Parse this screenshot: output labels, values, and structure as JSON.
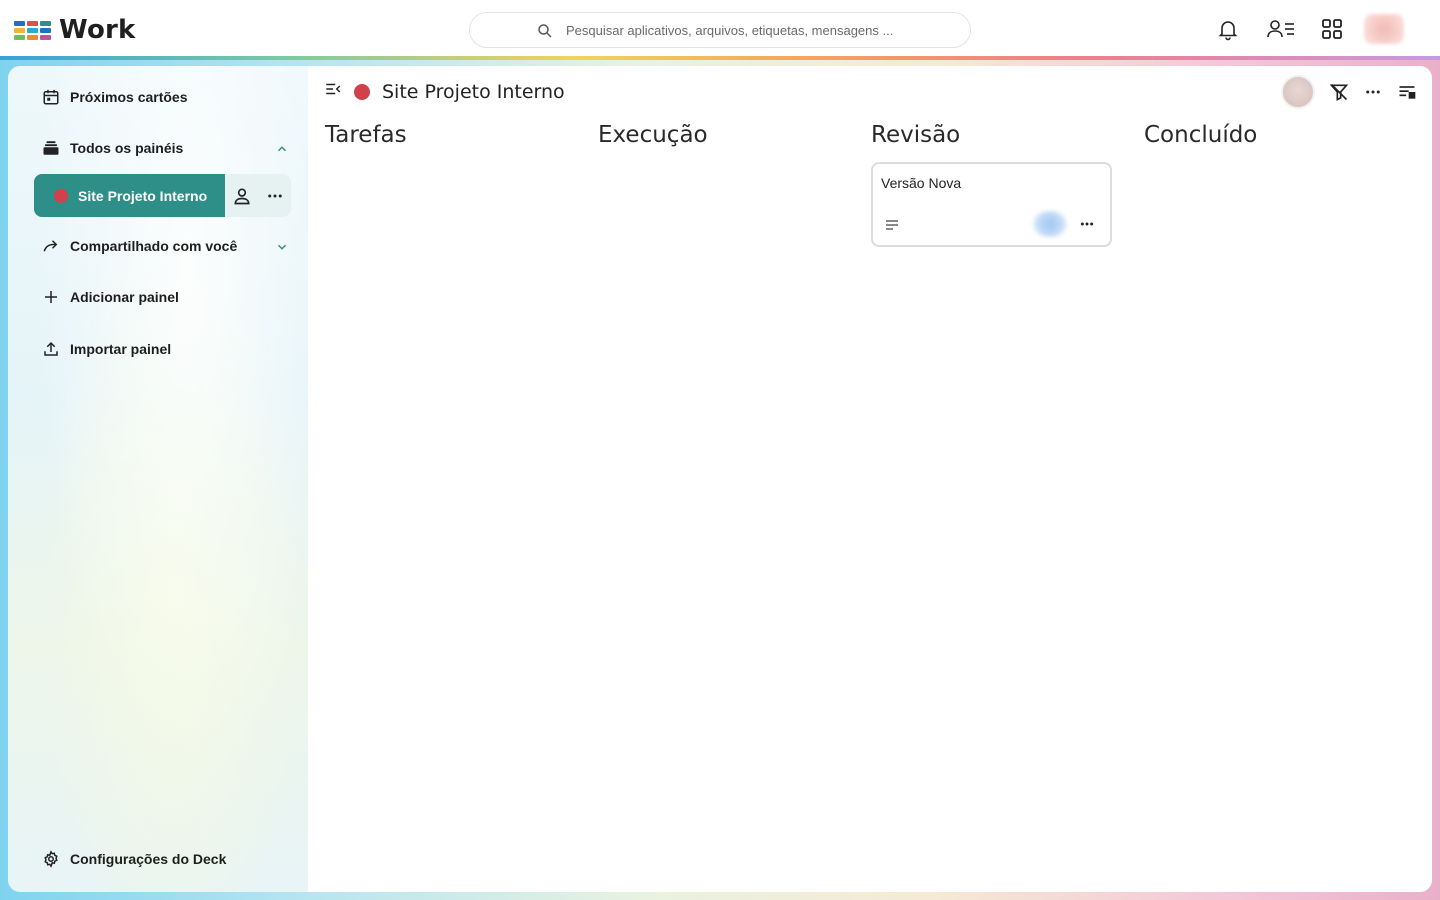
{
  "app": {
    "name": "Work",
    "logo_colors": [
      "#1e73be",
      "#e04f4f",
      "#2e8f88",
      "#f2b53a",
      "#2aa8d8",
      "#1e73be",
      "#6cbf5a",
      "#f08a3a",
      "#c44ea0"
    ]
  },
  "search": {
    "placeholder": "Pesquisar aplicativos, arquivos, etiquetas, mensagens ..."
  },
  "header_icons": [
    "bell-icon",
    "contacts-icon",
    "apps-grid-icon",
    "user-avatar"
  ],
  "sidebar": {
    "upcoming": "Próximos cartões",
    "all_boards": "Todos os painéis",
    "active_board": "Site Projeto Interno",
    "shared": "Compartilhado com você",
    "add_board": "Adicionar painel",
    "import_board": "Importar painel",
    "settings": "Configurações do Deck"
  },
  "board": {
    "title": "Site Projeto Interno",
    "color": "#d0414b",
    "stacks": [
      {
        "title": "Tarefas"
      },
      {
        "title": "Execução"
      },
      {
        "title": "Revisão"
      },
      {
        "title": "Concluído"
      }
    ],
    "cards": [
      {
        "title": "Versão Nova",
        "stack": "Revisão"
      }
    ]
  },
  "colors": {
    "accent": "#2e8f88",
    "board_dot": "#d0414b"
  }
}
